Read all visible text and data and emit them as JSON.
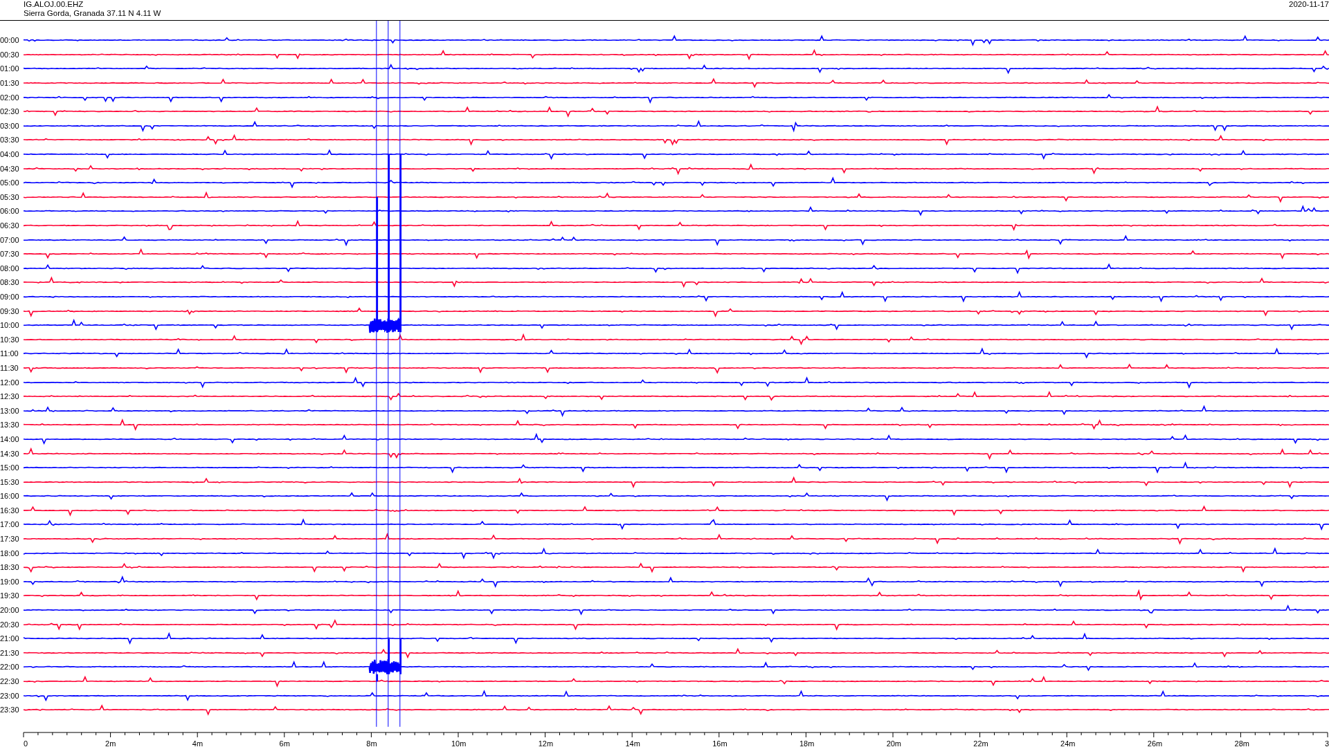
{
  "header": {
    "station": "IG.ALOJ.00.EHZ",
    "location": "Sierra Gorda, Granada  37.11 N 4.11 W",
    "date": "2020-11-17"
  },
  "rows": [
    {
      "label": "00:00",
      "color": "#0000ff"
    },
    {
      "label": "00:30",
      "color": "#ff0033"
    },
    {
      "label": "01:00",
      "color": "#0000ff"
    },
    {
      "label": "01:30",
      "color": "#ff0033"
    },
    {
      "label": "02:00",
      "color": "#0000ff"
    },
    {
      "label": "02:30",
      "color": "#ff0033"
    },
    {
      "label": "03:00",
      "color": "#0000ff"
    },
    {
      "label": "03:30",
      "color": "#ff0033"
    },
    {
      "label": "04:00",
      "color": "#0000ff"
    },
    {
      "label": "04:30",
      "color": "#ff0033"
    },
    {
      "label": "05:00",
      "color": "#0000ff"
    },
    {
      "label": "05:30",
      "color": "#ff0033"
    },
    {
      "label": "06:00",
      "color": "#0000ff"
    },
    {
      "label": "06:30",
      "color": "#ff0033"
    },
    {
      "label": "07:00",
      "color": "#0000ff"
    },
    {
      "label": "07:30",
      "color": "#ff0033"
    },
    {
      "label": "08:00",
      "color": "#0000ff"
    },
    {
      "label": "08:30",
      "color": "#ff0033"
    },
    {
      "label": "09:00",
      "color": "#0000ff"
    },
    {
      "label": "09:30",
      "color": "#ff0033"
    },
    {
      "label": "10:00",
      "color": "#0000ff"
    },
    {
      "label": "10:30",
      "color": "#ff0033"
    },
    {
      "label": "11:00",
      "color": "#0000ff"
    },
    {
      "label": "11:30",
      "color": "#ff0033"
    },
    {
      "label": "12:00",
      "color": "#0000ff"
    },
    {
      "label": "12:30",
      "color": "#ff0033"
    },
    {
      "label": "13:00",
      "color": "#0000ff"
    },
    {
      "label": "13:30",
      "color": "#ff0033"
    },
    {
      "label": "14:00",
      "color": "#0000ff"
    },
    {
      "label": "14:30",
      "color": "#ff0033"
    },
    {
      "label": "15:00",
      "color": "#0000ff"
    },
    {
      "label": "15:30",
      "color": "#ff0033"
    },
    {
      "label": "16:00",
      "color": "#0000ff"
    },
    {
      "label": "16:30",
      "color": "#ff0033"
    },
    {
      "label": "17:00",
      "color": "#0000ff"
    },
    {
      "label": "17:30",
      "color": "#ff0033"
    },
    {
      "label": "18:00",
      "color": "#0000ff"
    },
    {
      "label": "18:30",
      "color": "#ff0033"
    },
    {
      "label": "19:00",
      "color": "#0000ff"
    },
    {
      "label": "19:30",
      "color": "#ff0033"
    },
    {
      "label": "20:00",
      "color": "#0000ff"
    },
    {
      "label": "20:30",
      "color": "#ff0033"
    },
    {
      "label": "21:00",
      "color": "#0000ff"
    },
    {
      "label": "21:30",
      "color": "#ff0033"
    },
    {
      "label": "22:00",
      "color": "#0000ff"
    },
    {
      "label": "22:30",
      "color": "#ff0033"
    },
    {
      "label": "23:00",
      "color": "#0000ff"
    },
    {
      "label": "23:30",
      "color": "#ff0033"
    }
  ],
  "x_axis": {
    "ticks": [
      "0",
      "2m",
      "4m",
      "6m",
      "8m",
      "10m",
      "12m",
      "14m",
      "16m",
      "18m",
      "20m",
      "22m",
      "24m",
      "26m",
      "28m",
      "3"
    ]
  }
}
